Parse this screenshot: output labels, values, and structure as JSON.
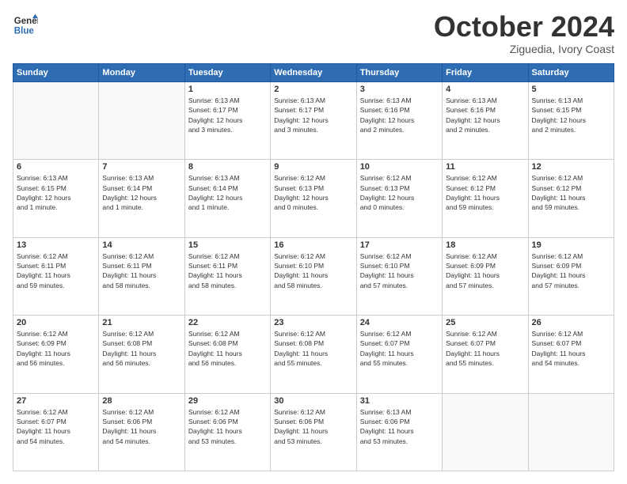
{
  "header": {
    "logo_line1": "General",
    "logo_line2": "Blue",
    "month": "October 2024",
    "location": "Ziguedia, Ivory Coast"
  },
  "weekdays": [
    "Sunday",
    "Monday",
    "Tuesday",
    "Wednesday",
    "Thursday",
    "Friday",
    "Saturday"
  ],
  "weeks": [
    [
      {
        "day": "",
        "info": ""
      },
      {
        "day": "",
        "info": ""
      },
      {
        "day": "1",
        "info": "Sunrise: 6:13 AM\nSunset: 6:17 PM\nDaylight: 12 hours\nand 3 minutes."
      },
      {
        "day": "2",
        "info": "Sunrise: 6:13 AM\nSunset: 6:17 PM\nDaylight: 12 hours\nand 3 minutes."
      },
      {
        "day": "3",
        "info": "Sunrise: 6:13 AM\nSunset: 6:16 PM\nDaylight: 12 hours\nand 2 minutes."
      },
      {
        "day": "4",
        "info": "Sunrise: 6:13 AM\nSunset: 6:16 PM\nDaylight: 12 hours\nand 2 minutes."
      },
      {
        "day": "5",
        "info": "Sunrise: 6:13 AM\nSunset: 6:15 PM\nDaylight: 12 hours\nand 2 minutes."
      }
    ],
    [
      {
        "day": "6",
        "info": "Sunrise: 6:13 AM\nSunset: 6:15 PM\nDaylight: 12 hours\nand 1 minute."
      },
      {
        "day": "7",
        "info": "Sunrise: 6:13 AM\nSunset: 6:14 PM\nDaylight: 12 hours\nand 1 minute."
      },
      {
        "day": "8",
        "info": "Sunrise: 6:13 AM\nSunset: 6:14 PM\nDaylight: 12 hours\nand 1 minute."
      },
      {
        "day": "9",
        "info": "Sunrise: 6:12 AM\nSunset: 6:13 PM\nDaylight: 12 hours\nand 0 minutes."
      },
      {
        "day": "10",
        "info": "Sunrise: 6:12 AM\nSunset: 6:13 PM\nDaylight: 12 hours\nand 0 minutes."
      },
      {
        "day": "11",
        "info": "Sunrise: 6:12 AM\nSunset: 6:12 PM\nDaylight: 11 hours\nand 59 minutes."
      },
      {
        "day": "12",
        "info": "Sunrise: 6:12 AM\nSunset: 6:12 PM\nDaylight: 11 hours\nand 59 minutes."
      }
    ],
    [
      {
        "day": "13",
        "info": "Sunrise: 6:12 AM\nSunset: 6:11 PM\nDaylight: 11 hours\nand 59 minutes."
      },
      {
        "day": "14",
        "info": "Sunrise: 6:12 AM\nSunset: 6:11 PM\nDaylight: 11 hours\nand 58 minutes."
      },
      {
        "day": "15",
        "info": "Sunrise: 6:12 AM\nSunset: 6:11 PM\nDaylight: 11 hours\nand 58 minutes."
      },
      {
        "day": "16",
        "info": "Sunrise: 6:12 AM\nSunset: 6:10 PM\nDaylight: 11 hours\nand 58 minutes."
      },
      {
        "day": "17",
        "info": "Sunrise: 6:12 AM\nSunset: 6:10 PM\nDaylight: 11 hours\nand 57 minutes."
      },
      {
        "day": "18",
        "info": "Sunrise: 6:12 AM\nSunset: 6:09 PM\nDaylight: 11 hours\nand 57 minutes."
      },
      {
        "day": "19",
        "info": "Sunrise: 6:12 AM\nSunset: 6:09 PM\nDaylight: 11 hours\nand 57 minutes."
      }
    ],
    [
      {
        "day": "20",
        "info": "Sunrise: 6:12 AM\nSunset: 6:09 PM\nDaylight: 11 hours\nand 56 minutes."
      },
      {
        "day": "21",
        "info": "Sunrise: 6:12 AM\nSunset: 6:08 PM\nDaylight: 11 hours\nand 56 minutes."
      },
      {
        "day": "22",
        "info": "Sunrise: 6:12 AM\nSunset: 6:08 PM\nDaylight: 11 hours\nand 56 minutes."
      },
      {
        "day": "23",
        "info": "Sunrise: 6:12 AM\nSunset: 6:08 PM\nDaylight: 11 hours\nand 55 minutes."
      },
      {
        "day": "24",
        "info": "Sunrise: 6:12 AM\nSunset: 6:07 PM\nDaylight: 11 hours\nand 55 minutes."
      },
      {
        "day": "25",
        "info": "Sunrise: 6:12 AM\nSunset: 6:07 PM\nDaylight: 11 hours\nand 55 minutes."
      },
      {
        "day": "26",
        "info": "Sunrise: 6:12 AM\nSunset: 6:07 PM\nDaylight: 11 hours\nand 54 minutes."
      }
    ],
    [
      {
        "day": "27",
        "info": "Sunrise: 6:12 AM\nSunset: 6:07 PM\nDaylight: 11 hours\nand 54 minutes."
      },
      {
        "day": "28",
        "info": "Sunrise: 6:12 AM\nSunset: 6:06 PM\nDaylight: 11 hours\nand 54 minutes."
      },
      {
        "day": "29",
        "info": "Sunrise: 6:12 AM\nSunset: 6:06 PM\nDaylight: 11 hours\nand 53 minutes."
      },
      {
        "day": "30",
        "info": "Sunrise: 6:12 AM\nSunset: 6:06 PM\nDaylight: 11 hours\nand 53 minutes."
      },
      {
        "day": "31",
        "info": "Sunrise: 6:13 AM\nSunset: 6:06 PM\nDaylight: 11 hours\nand 53 minutes."
      },
      {
        "day": "",
        "info": ""
      },
      {
        "day": "",
        "info": ""
      }
    ]
  ]
}
